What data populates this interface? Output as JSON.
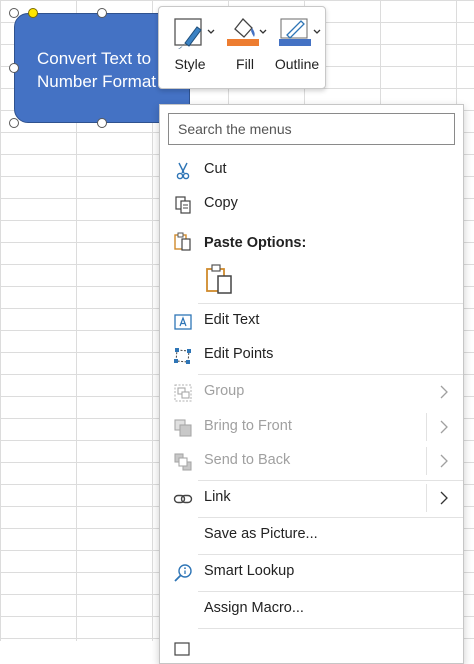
{
  "shape": {
    "text_line1": "Convert Text to",
    "text_line2": "Number Format",
    "fill_color": "#4472c4"
  },
  "toolbar": {
    "style_label": "Style",
    "fill_label": "Fill",
    "outline_label": "Outline",
    "fill_color": "#ed7d31",
    "outline_color": "#4472c4"
  },
  "menu": {
    "search_placeholder": "Search the menus",
    "cut": "Cut",
    "copy": "Copy",
    "paste_options": "Paste Options:",
    "edit_text": "Edit Text",
    "edit_points": "Edit Points",
    "group": "Group",
    "bring_to_front": "Bring to Front",
    "send_to_back": "Send to Back",
    "link": "Link",
    "save_as_picture": "Save as Picture...",
    "smart_lookup": "Smart Lookup",
    "assign_macro": "Assign Macro..."
  },
  "icons": {
    "cut": "scissors-icon",
    "copy": "copy-icon",
    "paste": "clipboard-icon",
    "edit_text": "text-box-icon",
    "edit_points": "edit-points-icon",
    "group": "group-icon",
    "bring_to_front": "bring-front-icon",
    "send_to_back": "send-back-icon",
    "link": "link-icon",
    "smart_lookup": "search-info-icon"
  }
}
